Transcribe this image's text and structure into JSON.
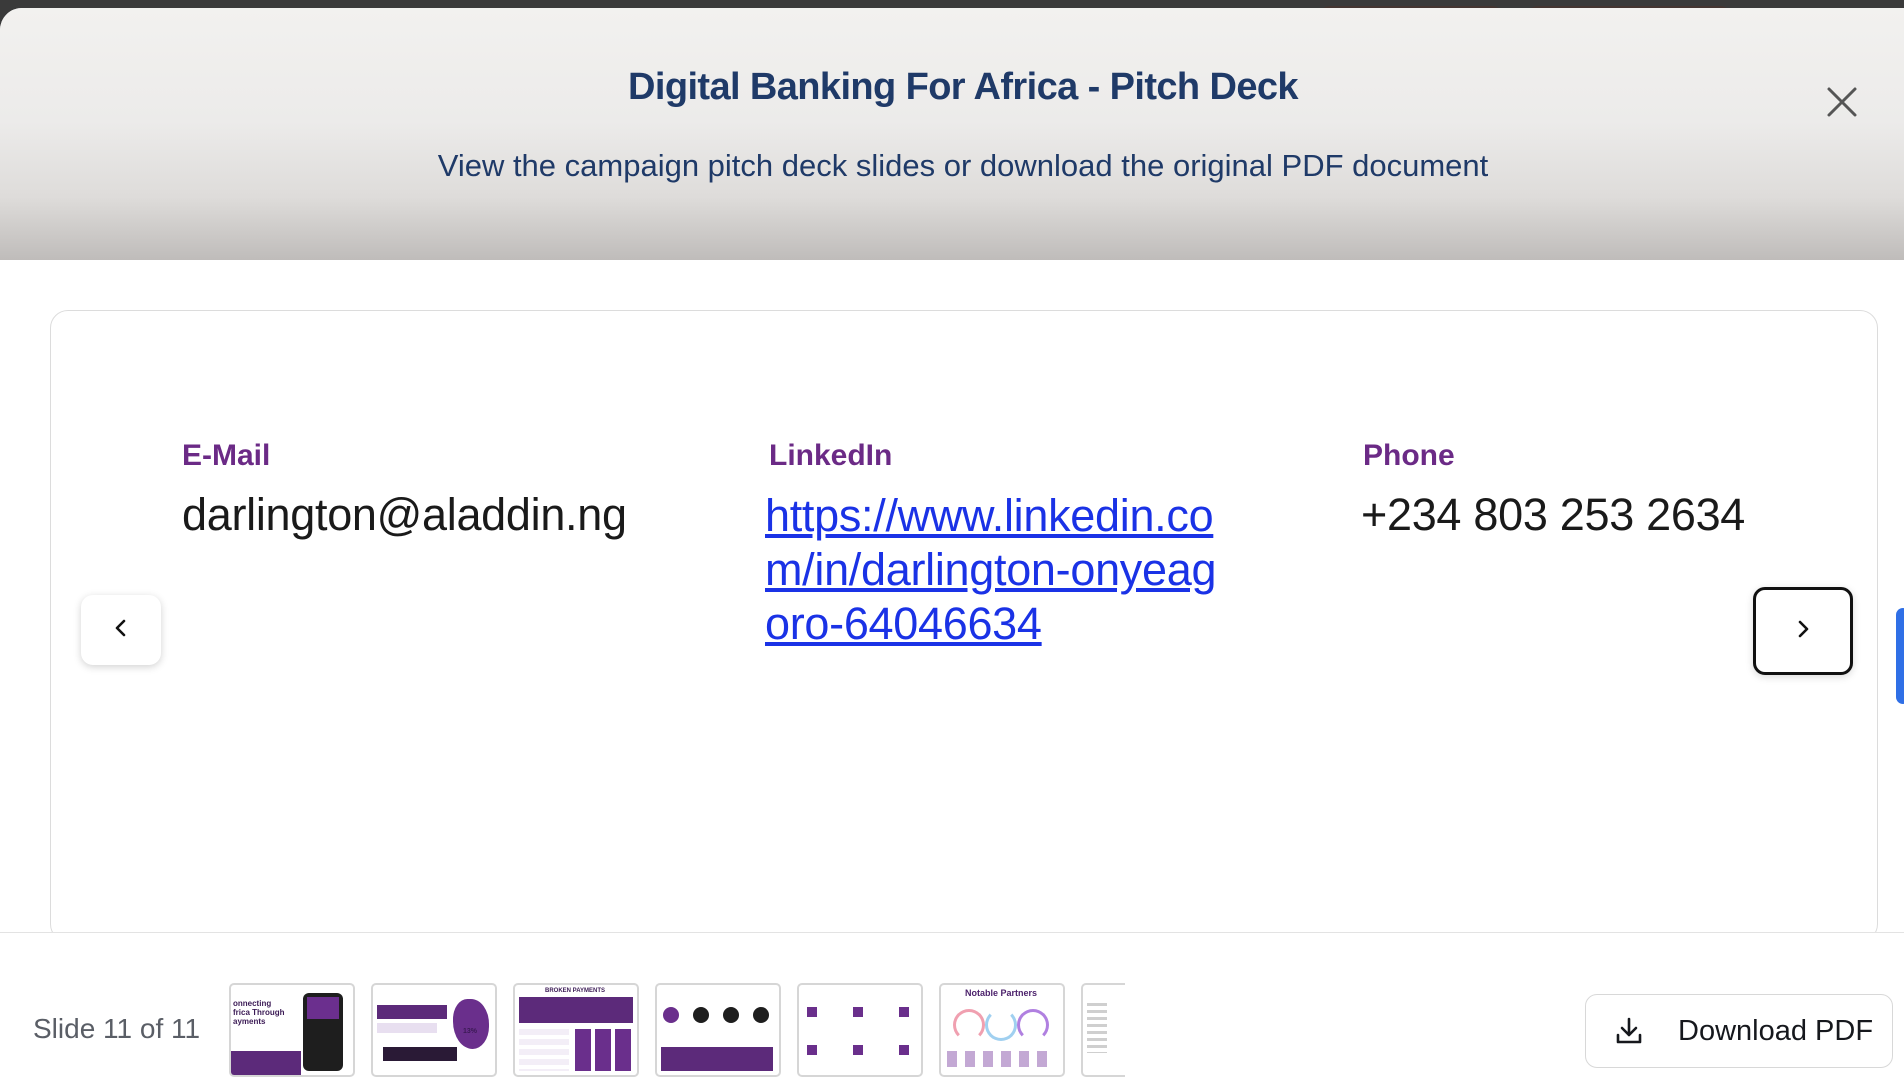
{
  "modal": {
    "title": "Digital Banking For Africa - Pitch Deck",
    "subtitle": "View the campaign pitch deck slides or download the original PDF document",
    "close_icon": "close-icon"
  },
  "slide": {
    "email": {
      "label": "E-Mail",
      "value": "darlington@aladdin.ng"
    },
    "linkedin": {
      "label": "LinkedIn",
      "value": "https://www.linkedin.com/in/darlington-onyeagoro-64046634"
    },
    "phone": {
      "label": "Phone",
      "value": "+234 803 253 2634"
    }
  },
  "navigation": {
    "prev_icon": "chevron-left-icon",
    "next_icon": "chevron-right-icon"
  },
  "footer": {
    "slide_counter": "Slide 11 of 11",
    "download_label": "Download PDF",
    "download_icon": "download-icon",
    "thumbnails": [
      {
        "text": "onnecting frica Through ayments"
      },
      {
        "text": "13%"
      },
      {
        "text": "BROKEN PAYMENTS"
      },
      {
        "text": ""
      },
      {
        "text": ""
      },
      {
        "text": "Notable Partners"
      },
      {
        "text": ""
      }
    ]
  },
  "colors": {
    "title": "#1f3a68",
    "label_purple": "#6b2a86",
    "link_blue": "#1a32e6",
    "accent_blue": "#2f6fe6"
  }
}
